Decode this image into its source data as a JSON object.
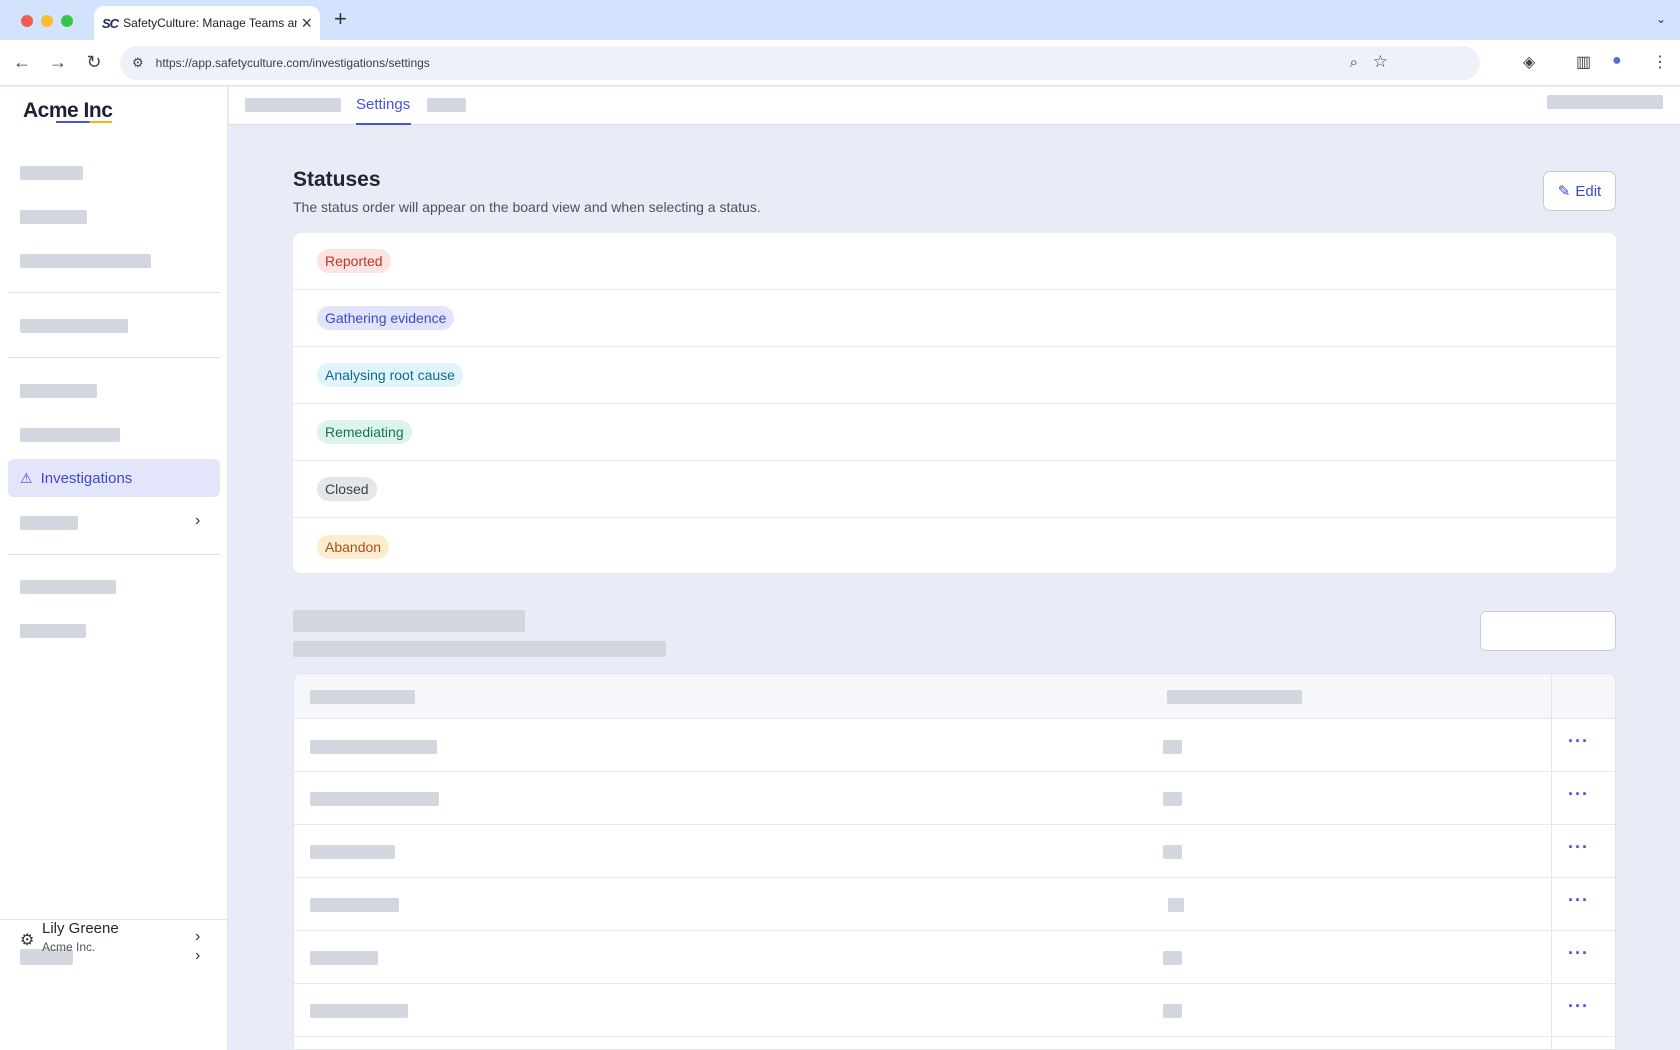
{
  "browser": {
    "tab_title": "SafetyCulture: Manage Teams and...",
    "tab_favicon": "SC",
    "url": "https://app.safetyculture.com/investigations/settings"
  },
  "sidebar": {
    "logo": "Acme Inc",
    "active_item": "Investigations",
    "user_name": "Lily Greene",
    "user_org": "Acme Inc."
  },
  "topbar": {
    "active_tab": "Settings"
  },
  "statuses": {
    "title": "Statuses",
    "description": "The status order will appear on the board view and when selecting a status.",
    "edit_label": "Edit",
    "items": [
      {
        "label": "Reported",
        "bg": "#fde3e1",
        "fg": "#b8372c"
      },
      {
        "label": "Gathering evidence",
        "bg": "#e2e4fd",
        "fg": "#3d49c9"
      },
      {
        "label": "Analysing root cause",
        "bg": "#dff4fb",
        "fg": "#136b8a"
      },
      {
        "label": "Remediating",
        "bg": "#dcf5ea",
        "fg": "#18744f"
      },
      {
        "label": "Closed",
        "bg": "#e4e6ea",
        "fg": "#3b4150"
      },
      {
        "label": "Abandon",
        "bg": "#fdeccf",
        "fg": "#a5501a"
      }
    ]
  },
  "table": {
    "row_menu_label": "···"
  }
}
